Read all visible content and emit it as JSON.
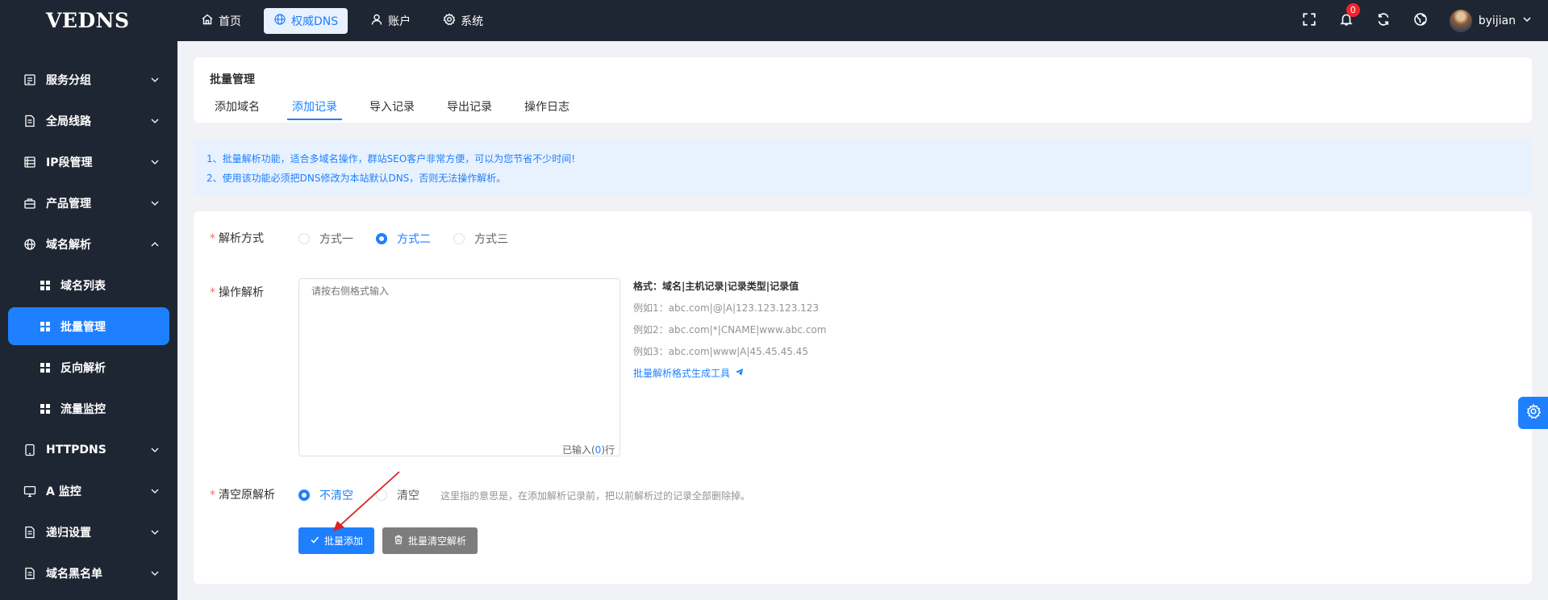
{
  "app": {
    "logo": "VEDNS"
  },
  "topnav": [
    {
      "label": "首页",
      "icon": "home-icon",
      "active": false
    },
    {
      "label": "权威DNS",
      "icon": "globe-icon",
      "active": true
    },
    {
      "label": "账户",
      "icon": "user-icon",
      "active": false
    },
    {
      "label": "系统",
      "icon": "gear-icon",
      "active": false
    }
  ],
  "topright": {
    "notification_count": "0",
    "username": "byijian"
  },
  "sidebar": {
    "items": [
      {
        "label": "服务分组",
        "icon": "server-group-icon"
      },
      {
        "label": "全局线路",
        "icon": "document-icon"
      },
      {
        "label": "IP段管理",
        "icon": "database-icon"
      },
      {
        "label": "产品管理",
        "icon": "box-icon"
      },
      {
        "label": "域名解析",
        "icon": "globe-icon"
      }
    ],
    "subitems": [
      {
        "label": "域名列表"
      },
      {
        "label": "批量管理"
      },
      {
        "label": "反向解析"
      },
      {
        "label": "流量监控"
      }
    ],
    "items2": [
      {
        "label": "HTTPDNS",
        "icon": "mobile-icon"
      },
      {
        "label": "A 监控",
        "icon": "monitor-icon"
      },
      {
        "label": "递归设置",
        "icon": "document-icon"
      },
      {
        "label": "域名黑名单",
        "icon": "document-icon"
      }
    ]
  },
  "page": {
    "title": "批量管理",
    "tabs": [
      "添加域名",
      "添加记录",
      "导入记录",
      "导出记录",
      "操作日志"
    ],
    "active_tab": 1
  },
  "notice": {
    "line1": "1、批量解析功能，适合多域名操作，群站SEO客户非常方便，可以为您节省不少时间!",
    "line2": "2、使用该功能必须把DNS修改为本站默认DNS，否则无法操作解析。"
  },
  "form": {
    "mode": {
      "label": "解析方式",
      "options": [
        "方式一",
        "方式二",
        "方式三"
      ],
      "selected": 1
    },
    "records": {
      "label": "操作解析",
      "placeholder": "请按右侧格式输入",
      "counter_prefix": "已输入(",
      "counter_value": "0",
      "counter_suffix": ")行"
    },
    "help": {
      "title": "格式：域名|主机记录|记录类型|记录值",
      "ex1": "例如1：abc.com|@|A|123.123.123.123",
      "ex2": "例如2：abc.com|*|CNAME|www.abc.com",
      "ex3": "例如3：abc.com|www|A|45.45.45.45",
      "link": "批量解析格式生成工具"
    },
    "clear": {
      "label": "清空原解析",
      "options": [
        "不清空",
        "清空"
      ],
      "selected": 0,
      "hint": "这里指的意思是，在添加解析记录前，把以前解析过的记录全部删除掉。"
    },
    "buttons": {
      "add": "批量添加",
      "clear_all": "批量清空解析"
    }
  }
}
